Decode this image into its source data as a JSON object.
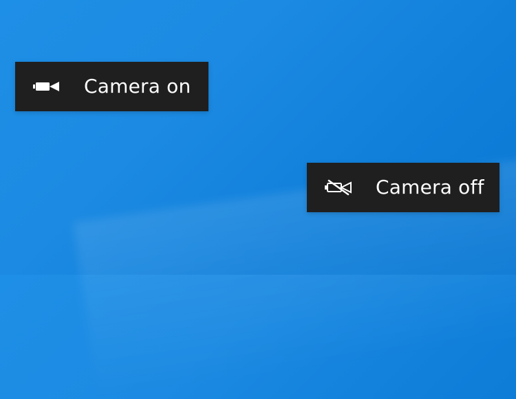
{
  "notifications": {
    "camera_on": {
      "label": "Camera on",
      "icon": "video-camera-icon"
    },
    "camera_off": {
      "label": "Camera off",
      "icon": "video-camera-off-icon"
    }
  },
  "colors": {
    "toast_background": "#1f1f1f",
    "toast_text": "#ffffff",
    "desktop_background": "#1c8ae2"
  }
}
